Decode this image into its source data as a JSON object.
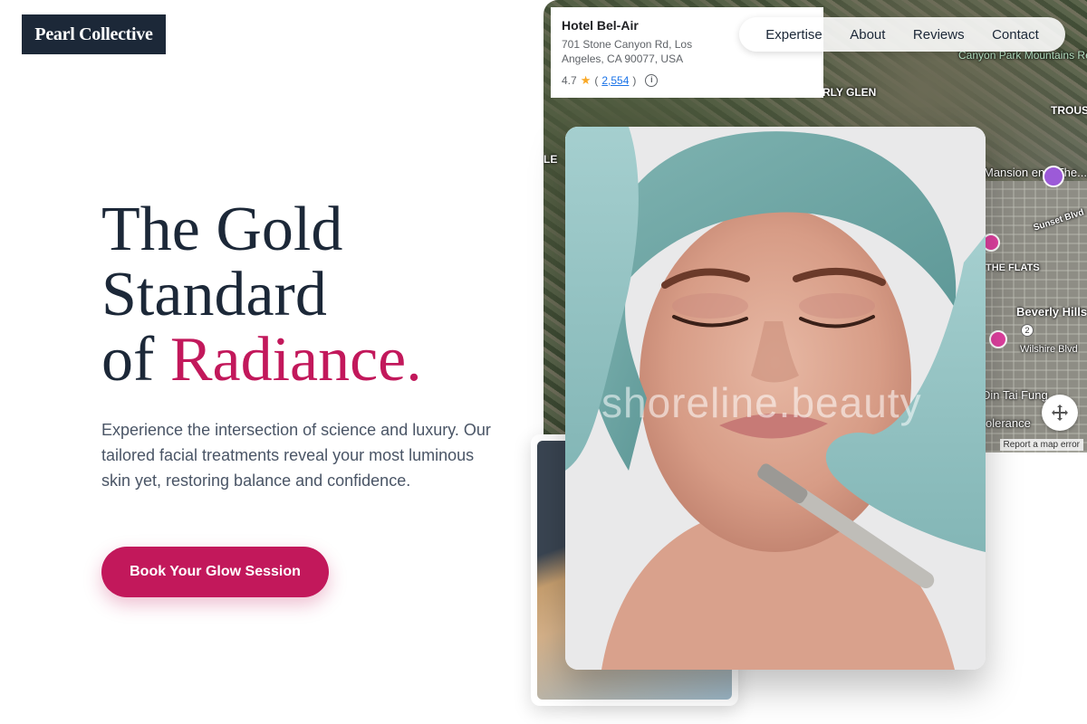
{
  "brand": {
    "logo_text": "Pearl Collective"
  },
  "nav": {
    "items": [
      {
        "label": "Expertise"
      },
      {
        "label": "About"
      },
      {
        "label": "Reviews"
      },
      {
        "label": "Contact"
      }
    ]
  },
  "hero": {
    "title_line1": "The Gold",
    "title_line2": "Standard",
    "title_line3_prefix": "of ",
    "title_line3_accent": "Radiance.",
    "description": "Experience the intersection of science and luxury. Our tailored facial treatments reveal your most luminous skin yet, restoring balance and confidence.",
    "cta_label": "Book Your Glow Session"
  },
  "map": {
    "place": {
      "name": "Hotel Bel-Air",
      "address": "701 Stone Canyon Rd, Los Angeles, CA 90077, USA",
      "rating": "4.7",
      "reviews": "2,554"
    },
    "labels": {
      "canyon_park": "Canyon Park Mountains Recreation...",
      "beverly_glen": "RLY GLEN",
      "trousdale": "TROUS ESTA",
      "mansion": "Mansion ens: The...",
      "sunset": "Sunset Blvd",
      "the_flats": "THE FLATS",
      "beverly_hills": "Beverly Hills",
      "wilshire": "Wilshire Blvd",
      "din_tai_fung": "Din Tai Fung",
      "tolerance": "olerance",
      "le": "LE",
      "pin_number": "2"
    },
    "attribution": "Report a map error"
  },
  "photo": {
    "watermark": "shoreline.beauty"
  },
  "colors": {
    "accent": "#c2185b",
    "navy": "#1c2838"
  }
}
